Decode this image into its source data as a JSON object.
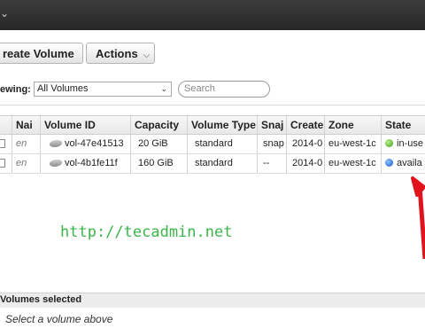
{
  "topbar": {
    "chevron_icon": "chevron-down-icon",
    "chevron_glyph": "⌄"
  },
  "toolbar": {
    "create_label": "reate Volume",
    "actions_label": "Actions",
    "actions_caret": "▼"
  },
  "filter": {
    "viewing_label": "ewing:",
    "view_value": "All Volumes",
    "search_placeholder": "Search"
  },
  "table": {
    "headers": [
      "Nai",
      "Volume ID",
      "Capacity",
      "Volume Type",
      "Snaj",
      "Create",
      "Zone",
      "State"
    ],
    "rows": [
      {
        "name": "en",
        "volume_id": "vol-47e41513",
        "capacity": "20 GiB",
        "type": "standard",
        "snapshot": "snap",
        "created": "2014-0",
        "zone": "eu-west-1c",
        "state": "in-use",
        "state_color": "#3c9a14"
      },
      {
        "name": "en",
        "volume_id": "vol-4b1fe11f",
        "capacity": "160 GiB",
        "type": "standard",
        "snapshot": "--",
        "created": "2014-0",
        "zone": "eu-west-1c",
        "state": "availa",
        "state_color": "#1456c9"
      }
    ]
  },
  "watermark": "http://tecadmin.net",
  "annotation": {
    "arrow_color": "#e0141e"
  },
  "footer": {
    "title": "Volumes selected",
    "hint": "Select a volume above"
  }
}
